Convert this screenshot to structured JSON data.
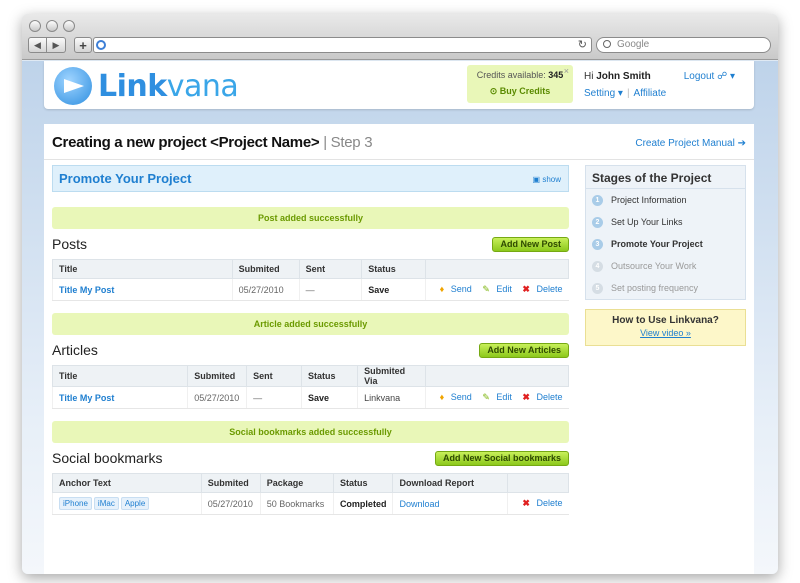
{
  "browser": {
    "search_placeholder": "Google",
    "reload_glyph": "↻",
    "back_glyph": "◀",
    "forward_glyph": "▶",
    "plus_glyph": "+"
  },
  "header": {
    "logo_part1": "Link",
    "logo_part2": "vana",
    "credits_label": "Credits available:",
    "credits_value": "345",
    "credits_close": "×",
    "buy_credits": "⊙ Buy Credits",
    "greeting": "Hi",
    "user_name": "John Smith",
    "logout": "Logout ☍ ▾",
    "setting": "Setting ▾",
    "affiliate": "Affiliate"
  },
  "title": {
    "main": "Creating a new project <Project Name>",
    "step": "| Step 3",
    "manual_link": "Create Project Manual ➔"
  },
  "promote": {
    "label": "Promote Your Project",
    "show": "▣ show"
  },
  "posts": {
    "success": "Post added successfully",
    "title": "Posts",
    "add_button": "Add New Post",
    "columns": [
      "Title",
      "Submited",
      "Sent",
      "Status",
      ""
    ],
    "rows": [
      {
        "title": "Title My Post",
        "submitted": "05/27/2010",
        "sent": "—",
        "status": "Save"
      }
    ]
  },
  "articles": {
    "success": "Article added successfully",
    "title": "Articles",
    "add_button": "Add New Articles",
    "columns": [
      "Title",
      "Submited",
      "Sent",
      "Status",
      "Submited Via",
      ""
    ],
    "rows": [
      {
        "title": "Title My Post",
        "submitted": "05/27/2010",
        "sent": "—",
        "status": "Save",
        "via": "Linkvana"
      }
    ]
  },
  "bookmarks": {
    "success": "Social bookmarks added successfully",
    "title": "Social bookmarks",
    "add_button": "Add New Social bookmarks",
    "columns": [
      "Anchor Text",
      "Submited",
      "Package",
      "Status",
      "Download Report",
      ""
    ],
    "rows": [
      {
        "tags": [
          "iPhone",
          "iMac",
          "Apple"
        ],
        "submitted": "05/27/2010",
        "package": "50 Bookmarks",
        "status": "Completed",
        "report": "Download"
      }
    ]
  },
  "actions": {
    "send": "Send",
    "edit": "Edit",
    "delete": "Delete",
    "send_icon": "♦",
    "edit_icon": "✎",
    "delete_icon": "✖"
  },
  "stages": {
    "title": "Stages of the Project",
    "items": [
      {
        "num": "1",
        "label": "Project Information"
      },
      {
        "num": "2",
        "label": "Set Up Your Links"
      },
      {
        "num": "3",
        "label": "Promote Your Project"
      },
      {
        "num": "4",
        "label": "Outsource Your Work"
      },
      {
        "num": "5",
        "label": "Set posting frequency"
      }
    ]
  },
  "howto": {
    "title": "How to Use Linkvana?",
    "video": "View video »"
  },
  "colors": {
    "accent": "#1f7fd0",
    "success_bg": "#e9f7b8",
    "button_green": "#8cc81c",
    "delete_red": "#e02020"
  }
}
